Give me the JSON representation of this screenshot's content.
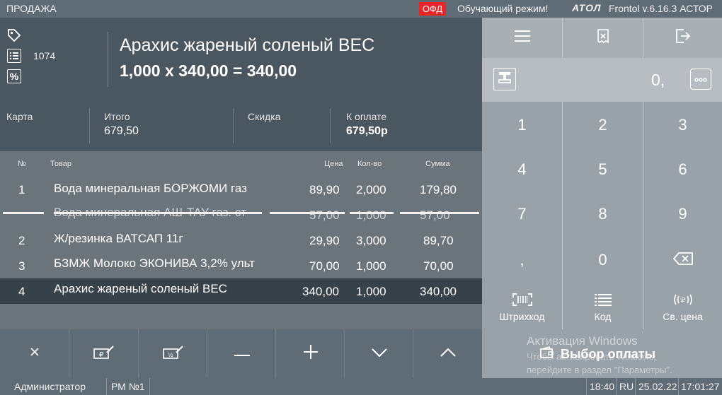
{
  "topbar": {
    "mode": "ПРОДАЖА",
    "ofd": "ОФД",
    "training": "Обучающий режим!",
    "brand": "АТОЛ",
    "version": "Frontol v.6.16.3 АСТОР"
  },
  "product": {
    "code": "1074",
    "name": "Арахис жареный соленый ВЕС",
    "calc": "1,000 x 340,00 = 340,00"
  },
  "summary": {
    "card_label": "Карта",
    "total_label": "Итого",
    "total_value": "679,50",
    "discount_label": "Скидка",
    "payable_label": "К оплате",
    "payable_value": "679,50р"
  },
  "table": {
    "headers": {
      "num": "№",
      "item": "Товар",
      "price": "Цена",
      "qty": "Кол-во",
      "sum": "Сумма"
    },
    "rows": [
      {
        "num": "1",
        "item": "Вода минеральная БОРЖОМИ газ",
        "price": "89,90",
        "qty": "2,000",
        "sum": "179,80"
      },
      {
        "num": "",
        "item": "Вода минеральная АШ-ТАУ газ. ст",
        "price": "57,00",
        "qty": "1,000",
        "sum": "57,00"
      },
      {
        "num": "2",
        "item": "Ж/резинка ВАТСАП 11г",
        "price": "29,90",
        "qty": "3,000",
        "sum": "89,70"
      },
      {
        "num": "3",
        "item": "БЗМЖ Молоко ЭКОНИВА 3,2% ульт",
        "price": "70,00",
        "qty": "1,000",
        "sum": "70,00"
      },
      {
        "num": "4",
        "item": "Арахис жареный соленый ВЕС",
        "price": "340,00",
        "qty": "1,000",
        "sum": "340,00"
      }
    ]
  },
  "keypad": {
    "display": "0,",
    "digits": [
      "1",
      "2",
      "3",
      "4",
      "5",
      "6",
      "7",
      "8",
      "9",
      ",",
      "0"
    ],
    "barcode_label": "Штрихкод",
    "code_label": "Код",
    "free_price_label": "Св. цена"
  },
  "payment": {
    "button_label": "Выбор оплаты"
  },
  "watermark": {
    "line1": "Активация Windows",
    "line2": "Чтобы активировать Windows,",
    "line3": "перейдите в раздел \"Параметры\"."
  },
  "statusbar": {
    "user": "Администратор",
    "workstation": "РМ №1",
    "time": "18:40",
    "lang": "RU",
    "date": "25.02.22",
    "clock": "17:01:27"
  },
  "colors": {
    "accent_red": "#e8262a",
    "panel_dark": "#4a5660",
    "selected_row": "#36414a",
    "keypad_bg": "#9aa2a9"
  }
}
